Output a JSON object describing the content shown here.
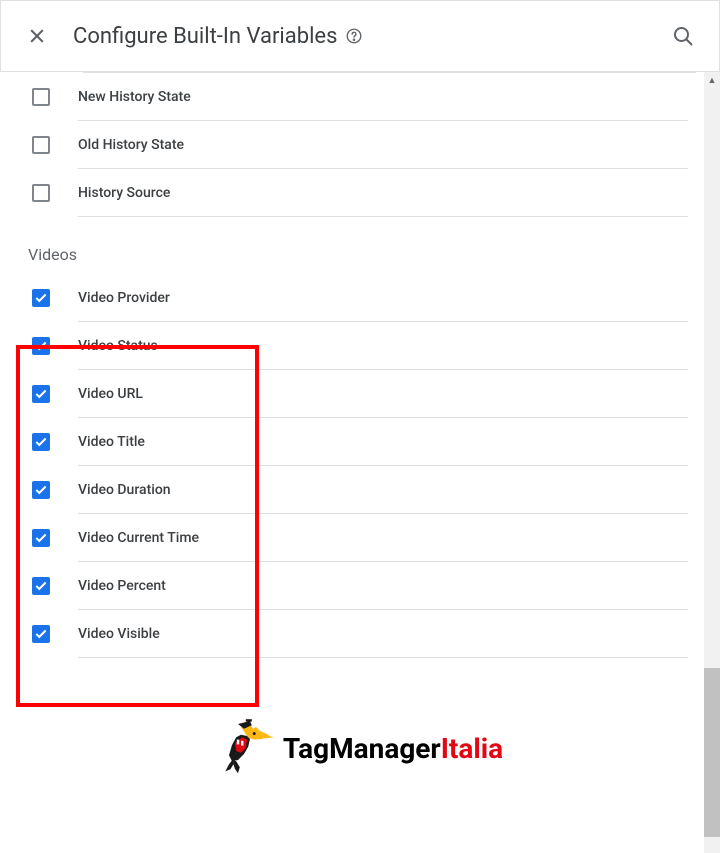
{
  "header": {
    "title": "Configure Built-In Variables"
  },
  "sections": {
    "history": {
      "items": [
        {
          "label": "New History State",
          "checked": false
        },
        {
          "label": "Old History State",
          "checked": false
        },
        {
          "label": "History Source",
          "checked": false
        }
      ]
    },
    "videos": {
      "title": "Videos",
      "items": [
        {
          "label": "Video Provider",
          "checked": true
        },
        {
          "label": "Video Status",
          "checked": true
        },
        {
          "label": "Video URL",
          "checked": true
        },
        {
          "label": "Video Title",
          "checked": true
        },
        {
          "label": "Video Duration",
          "checked": true
        },
        {
          "label": "Video Current Time",
          "checked": true
        },
        {
          "label": "Video Percent",
          "checked": true
        },
        {
          "label": "Video Visible",
          "checked": true
        }
      ]
    }
  },
  "logo": {
    "part1": "TagManager",
    "part2": "Italia"
  }
}
